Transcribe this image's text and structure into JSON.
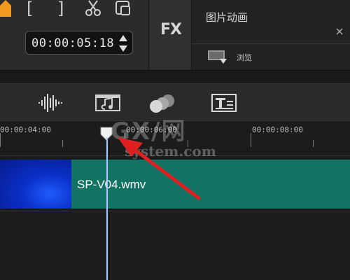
{
  "header": {
    "timecode": "00:00:05:18",
    "fx_label": "FX",
    "animation_label": "图片动画",
    "browse_label": "浏览"
  },
  "ruler": {
    "labels": [
      "00:00:04:00",
      "00:00:06:00",
      "00:00:08:00"
    ]
  },
  "timeline": {
    "clip_name": "SP-V04.wmv"
  },
  "watermark": {
    "logo": "GX/网",
    "url": "system.com"
  },
  "icons": {
    "marker": "marker-icon",
    "mark_in": "bracket-open",
    "mark_out": "bracket-close",
    "split": "scissors-icon",
    "snapshot": "snapshot-icon",
    "audio_mix": "waveform-icon",
    "auto_music": "music-note-icon",
    "motion": "circles-icon",
    "title": "title-icon"
  },
  "colors": {
    "clip_teal": "#127264",
    "clip_blue": "#0b2fc7",
    "playhead": "#a8c8ff",
    "arrow": "#e02020",
    "marker_orange": "#f29a1d"
  }
}
